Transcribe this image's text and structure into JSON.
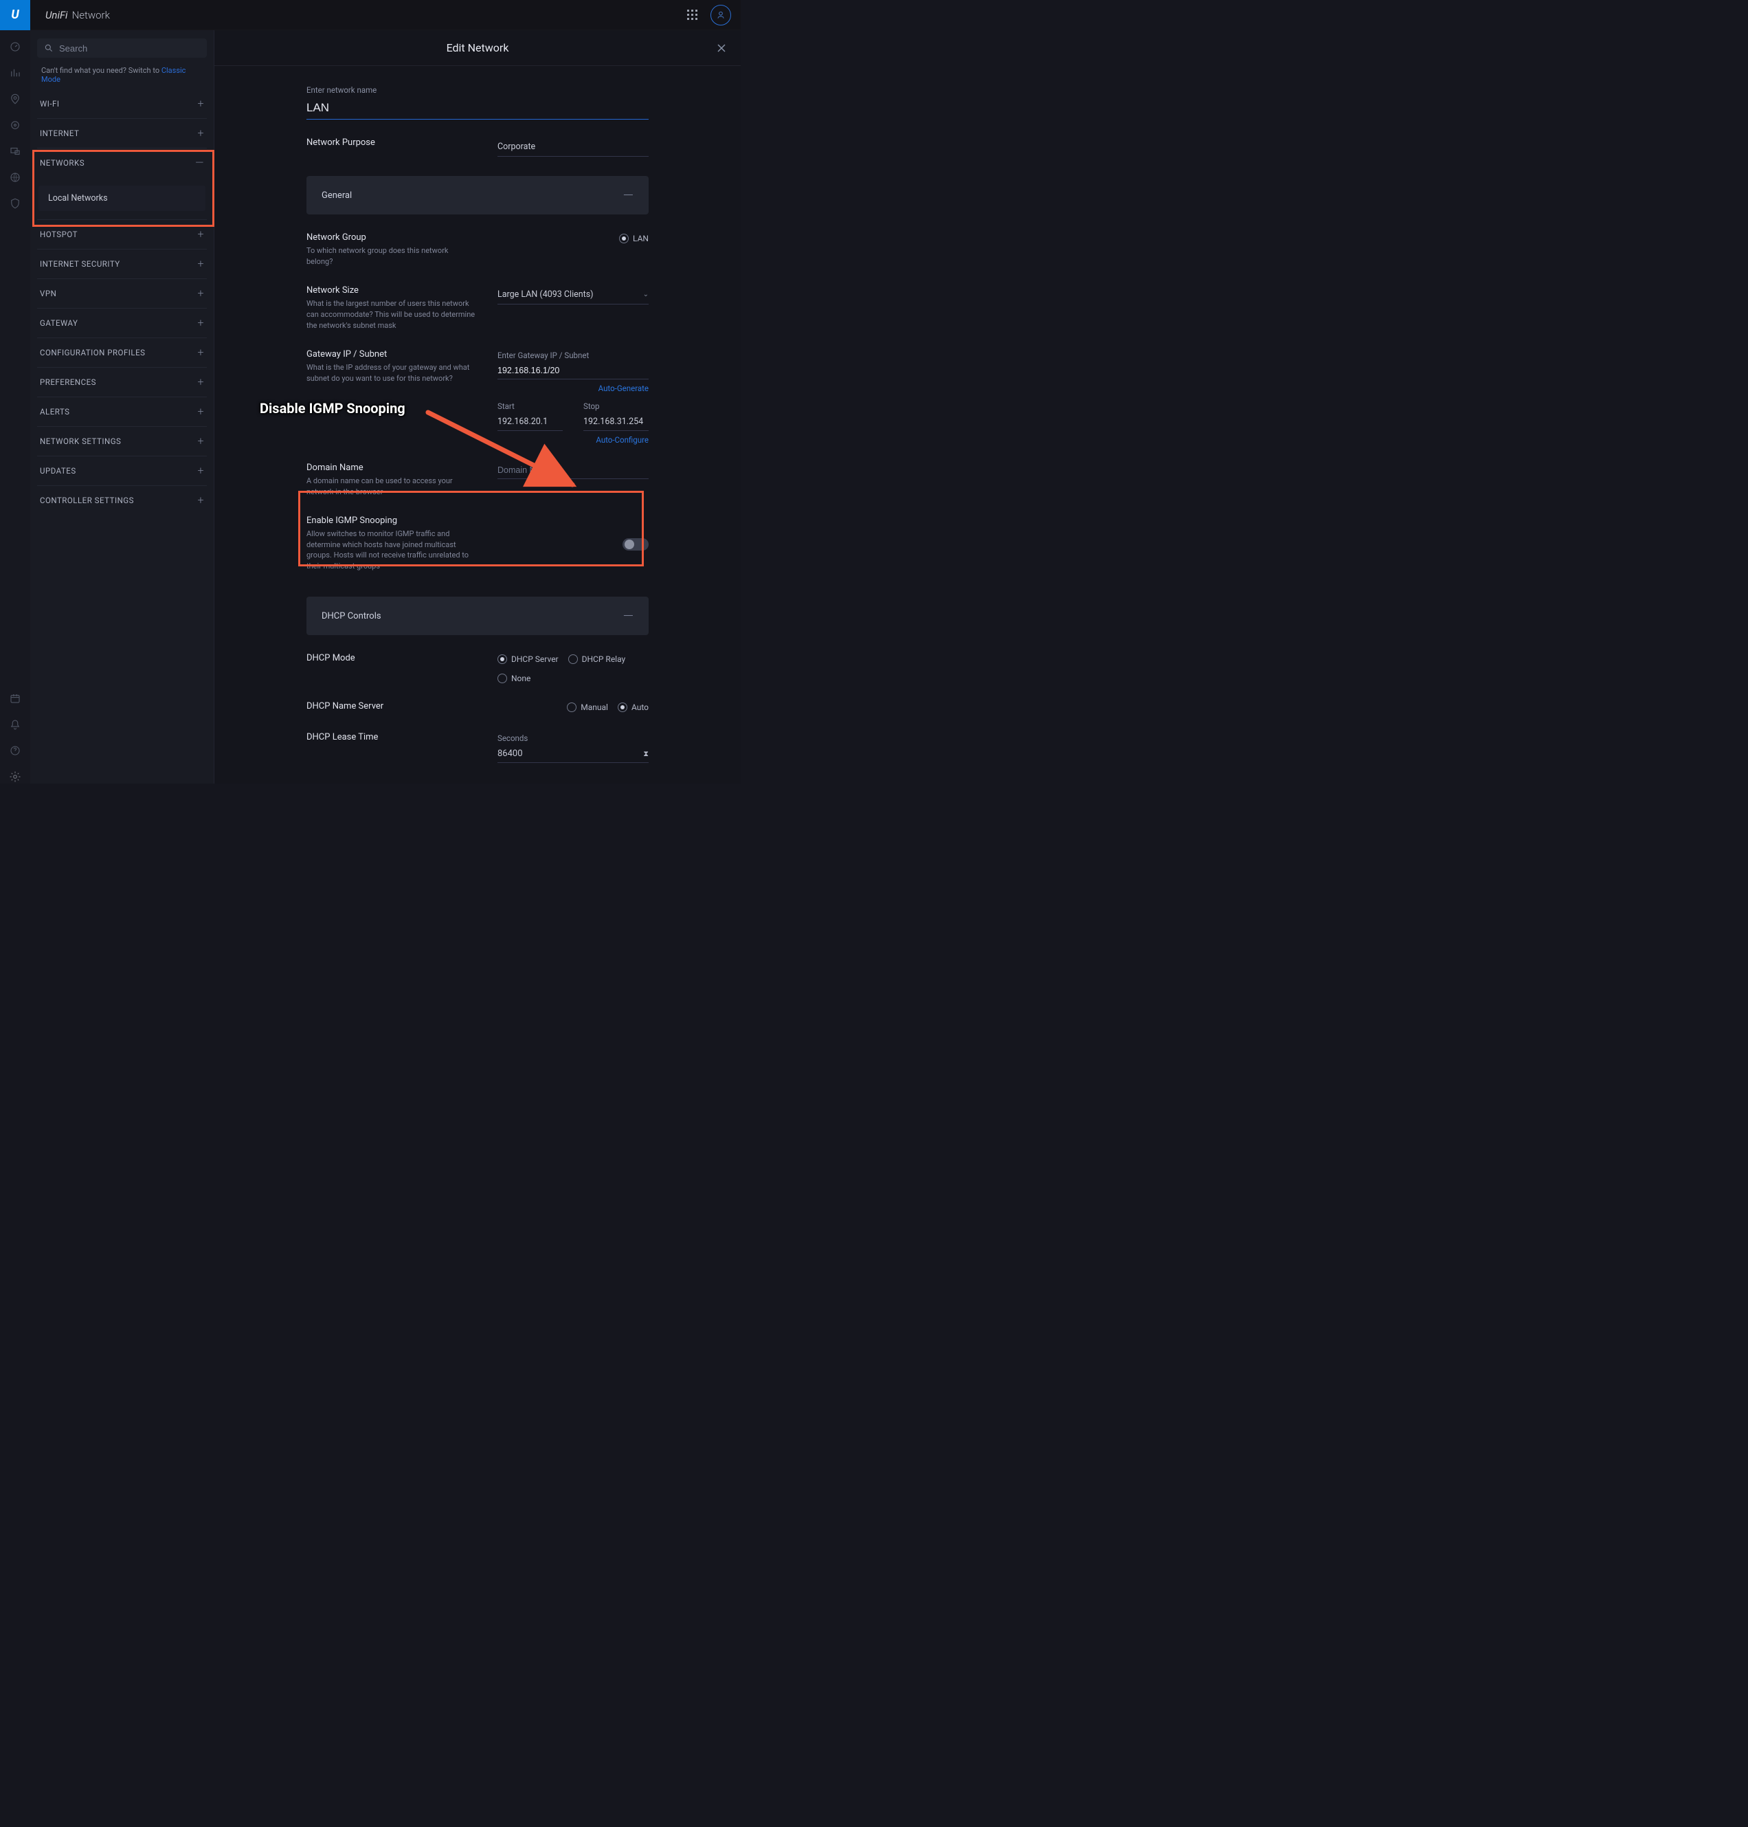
{
  "topbar": {
    "logo": "U",
    "brand_unifi": "UniFi",
    "brand_net": "Network"
  },
  "search": {
    "placeholder": "Search"
  },
  "hint": {
    "text": "Can't find what you need? Switch to ",
    "link": "Classic Mode"
  },
  "sidebar": {
    "items": [
      {
        "label": "WI-FI",
        "state": "plus"
      },
      {
        "label": "INTERNET",
        "state": "plus"
      },
      {
        "label": "NETWORKS",
        "state": "minus"
      },
      {
        "label": "HOTSPOT",
        "state": "plus"
      },
      {
        "label": "INTERNET SECURITY",
        "state": "plus"
      },
      {
        "label": "VPN",
        "state": "plus"
      },
      {
        "label": "GATEWAY",
        "state": "plus"
      },
      {
        "label": "CONFIGURATION PROFILES",
        "state": "plus"
      },
      {
        "label": "PREFERENCES",
        "state": "plus"
      },
      {
        "label": "ALERTS",
        "state": "plus"
      },
      {
        "label": "NETWORK SETTINGS",
        "state": "plus"
      },
      {
        "label": "UPDATES",
        "state": "plus"
      },
      {
        "label": "CONTROLLER SETTINGS",
        "state": "plus"
      }
    ],
    "subitem": "Local Networks"
  },
  "main": {
    "title": "Edit Network",
    "enter_name_label": "Enter network name",
    "name_value": "LAN",
    "purpose": {
      "label": "Network Purpose",
      "value": "Corporate"
    },
    "section_general": "General",
    "network_group": {
      "label": "Network Group",
      "desc": "To which network group does this network belong?",
      "value": "LAN"
    },
    "network_size": {
      "label": "Network Size",
      "desc": "What is the largest number of users this network can accommodate? This will be used to determine the network's subnet mask",
      "value": "Large LAN (4093 Clients)"
    },
    "gateway": {
      "label": "Gateway IP / Subnet",
      "desc": "What is the IP address of your gateway and what subnet do you want to use for this network?",
      "placeholder": "Enter Gateway IP / Subnet",
      "value": "192.168.16.1/20",
      "auto": "Auto-Generate"
    },
    "callout": "Disable IGMP Snooping",
    "dhcp_range": {
      "start_label": "Start",
      "start_value": "192.168.20.1",
      "stop_label": "Stop",
      "stop_value": "192.168.31.254",
      "auto": "Auto-Configure"
    },
    "domain": {
      "label": "Domain Name",
      "desc": "A domain name can be used to access your network in the browser",
      "placeholder": "Domain Name"
    },
    "igmp": {
      "label": "Enable IGMP Snooping",
      "desc": "Allow switches to monitor IGMP traffic and determine which hosts have joined multicast groups. Hosts will not receive traffic unrelated to their multicast groups"
    },
    "section_dhcp": "DHCP Controls",
    "dhcp_mode": {
      "label": "DHCP Mode",
      "opts": [
        "DHCP Server",
        "DHCP Relay",
        "None"
      ]
    },
    "dhcp_ns": {
      "label": "DHCP Name Server",
      "opts": [
        "Manual",
        "Auto"
      ]
    },
    "dhcp_lease": {
      "label": "DHCP Lease Time",
      "unit": "Seconds",
      "value": "86400",
      "icon": "⧗"
    }
  }
}
